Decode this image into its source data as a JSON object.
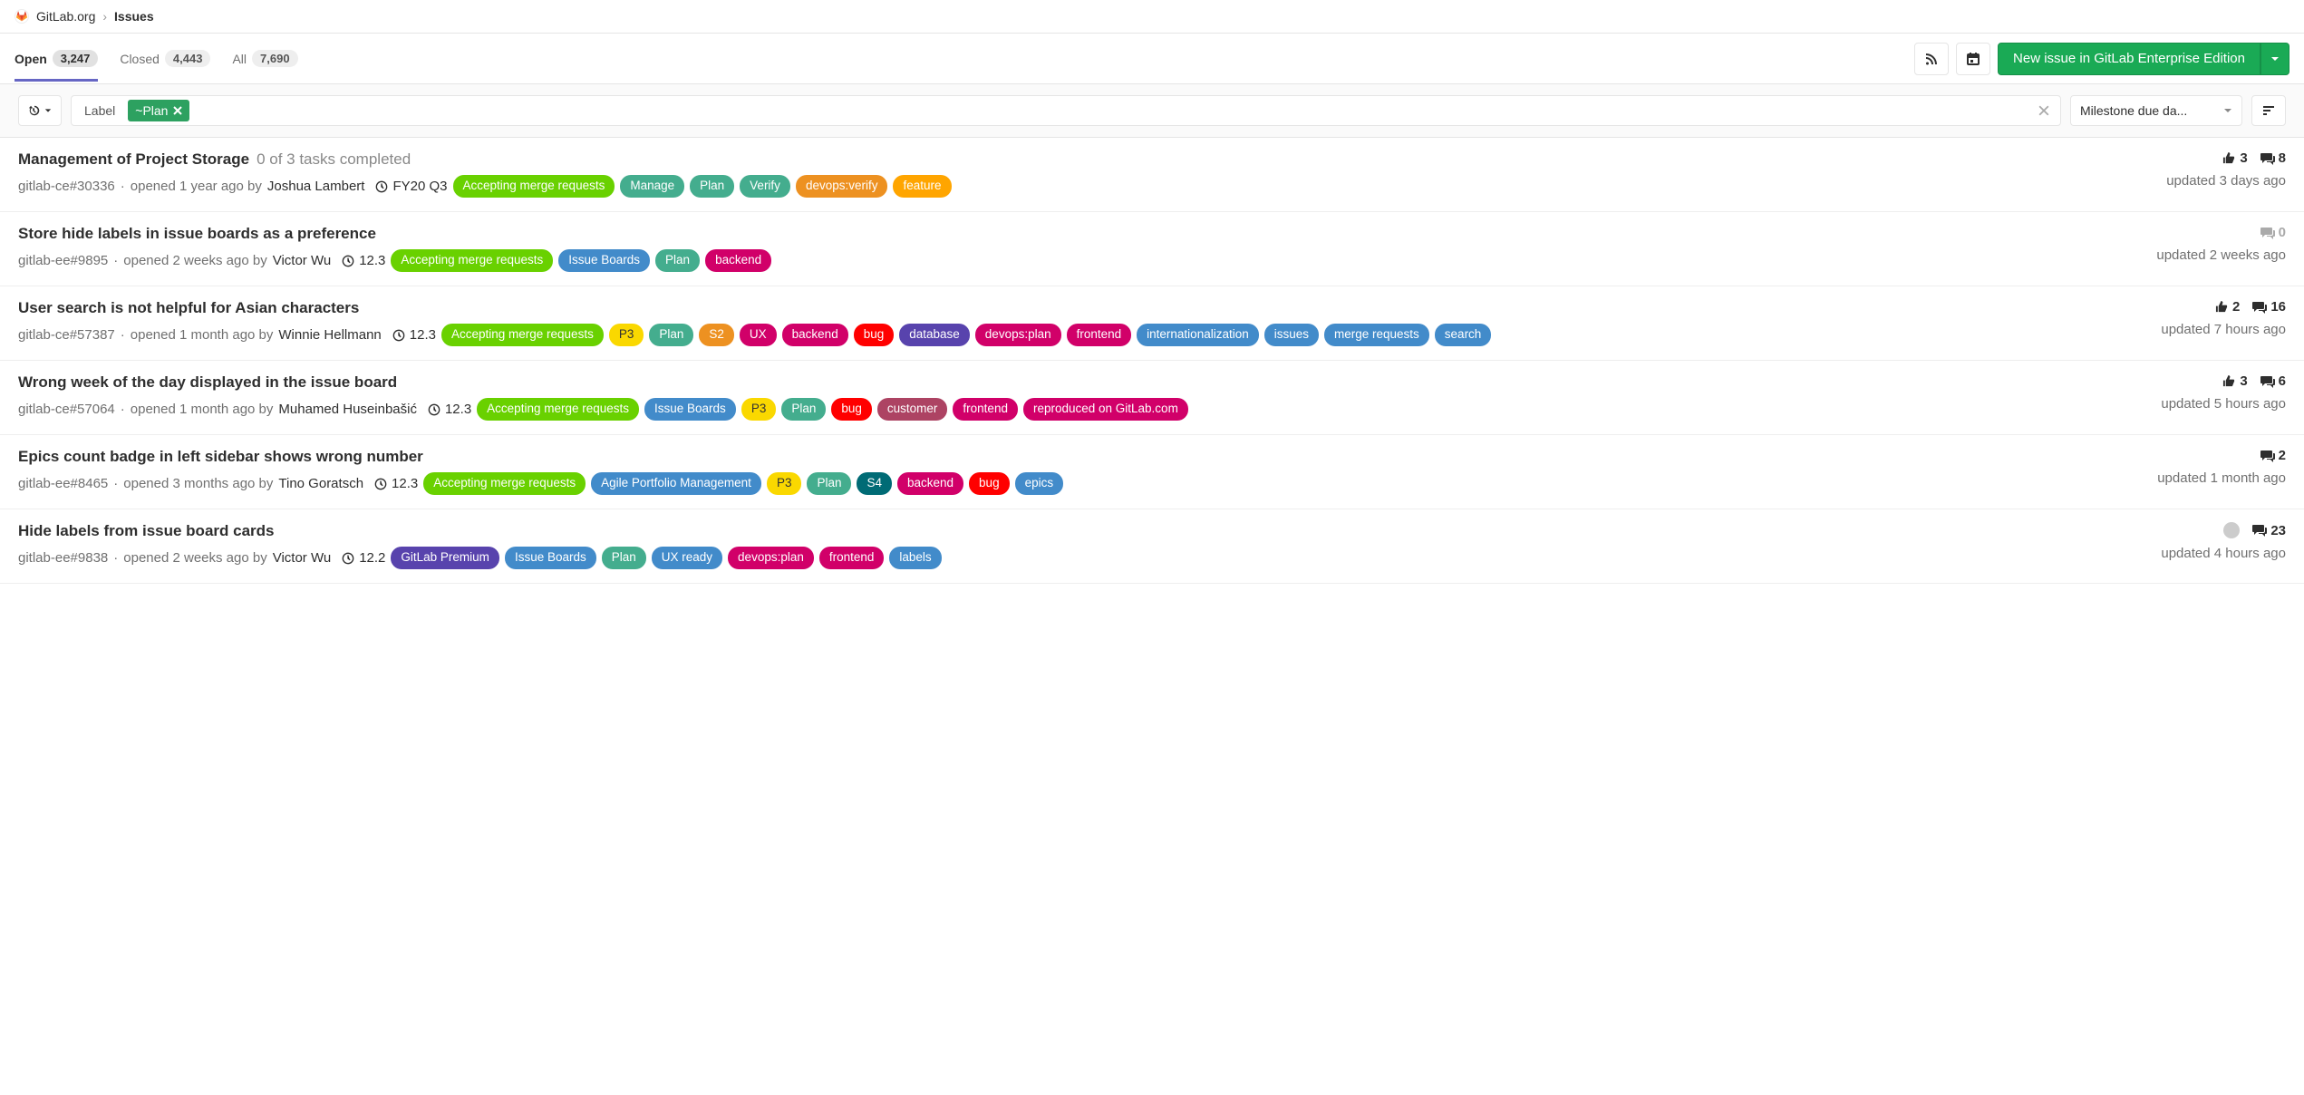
{
  "breadcrumb": {
    "group": "GitLab.org",
    "page": "Issues"
  },
  "tabs": {
    "open": {
      "label": "Open",
      "count": "3,247"
    },
    "closed": {
      "label": "Closed",
      "count": "4,443"
    },
    "all": {
      "label": "All",
      "count": "7,690"
    }
  },
  "new_issue_button": "New issue in GitLab Enterprise Edition",
  "filter": {
    "token_label": "Label",
    "token_value": "~Plan",
    "sort": "Milestone due da..."
  },
  "label_colors": {
    "Accepting merge requests": "#69d100",
    "Manage": "#44ad8e",
    "Plan": "#44ad8e",
    "Verify": "#44ad8e",
    "devops:verify": "#ed9121",
    "feature": "#ffa500",
    "Issue Boards": "#428bca",
    "backend": "#d10069",
    "P3": "#fad800",
    "S2": "#ed9121",
    "UX": "#d10069",
    "bug": "#ff0000",
    "database": "#5843ad",
    "devops:plan": "#d10069",
    "frontend": "#d10069",
    "internationalization": "#428bca",
    "issues": "#428bca",
    "merge requests": "#428bca",
    "search": "#428bca",
    "customer": "#ad4363",
    "reproduced on GitLab.com": "#d10069",
    "Agile Portfolio Management": "#428bca",
    "S4": "#006b75",
    "epics": "#428bca",
    "GitLab Premium": "#5843ad",
    "UX ready": "#428bca",
    "labels": "#428bca"
  },
  "issues": [
    {
      "title": "Management of Project Storage",
      "tasks": "0 of 3 tasks completed",
      "ref": "gitlab-ce#30336",
      "opened": "opened 1 year ago by",
      "author": "Joshua Lambert",
      "milestone": "FY20 Q3",
      "labels": [
        "Accepting merge requests",
        "Manage",
        "Plan",
        "Verify",
        "devops:verify",
        "feature"
      ],
      "thumbs": "3",
      "comments": "8",
      "updated": "updated 3 days ago",
      "has_avatar": false,
      "comments_muted": false
    },
    {
      "title": "Store hide labels in issue boards as a preference",
      "tasks": "",
      "ref": "gitlab-ee#9895",
      "opened": "opened 2 weeks ago by",
      "author": "Victor Wu",
      "milestone": "12.3",
      "labels": [
        "Accepting merge requests",
        "Issue Boards",
        "Plan",
        "backend"
      ],
      "thumbs": "",
      "comments": "0",
      "updated": "updated 2 weeks ago",
      "has_avatar": false,
      "comments_muted": true
    },
    {
      "title": "User search is not helpful for Asian characters",
      "tasks": "",
      "ref": "gitlab-ce#57387",
      "opened": "opened 1 month ago by",
      "author": "Winnie Hellmann",
      "milestone": "12.3",
      "labels": [
        "Accepting merge requests",
        "P3",
        "Plan",
        "S2",
        "UX",
        "backend",
        "bug",
        "database",
        "devops:plan",
        "frontend",
        "internationalization",
        "issues",
        "merge requests",
        "search"
      ],
      "thumbs": "2",
      "comments": "16",
      "updated": "updated 7 hours ago",
      "has_avatar": false,
      "comments_muted": false
    },
    {
      "title": "Wrong week of the day displayed in the issue board",
      "tasks": "",
      "ref": "gitlab-ce#57064",
      "opened": "opened 1 month ago by",
      "author": "Muhamed Huseinbašić",
      "milestone": "12.3",
      "labels": [
        "Accepting merge requests",
        "Issue Boards",
        "P3",
        "Plan",
        "bug",
        "customer",
        "frontend",
        "reproduced on GitLab.com"
      ],
      "thumbs": "3",
      "comments": "6",
      "updated": "updated 5 hours ago",
      "has_avatar": false,
      "comments_muted": false
    },
    {
      "title": "Epics count badge in left sidebar shows wrong number",
      "tasks": "",
      "ref": "gitlab-ee#8465",
      "opened": "opened 3 months ago by",
      "author": "Tino Goratsch",
      "milestone": "12.3",
      "labels": [
        "Accepting merge requests",
        "Agile Portfolio Management",
        "P3",
        "Plan",
        "S4",
        "backend",
        "bug",
        "epics"
      ],
      "thumbs": "",
      "comments": "2",
      "updated": "updated 1 month ago",
      "has_avatar": false,
      "comments_muted": false
    },
    {
      "title": "Hide labels from issue board cards",
      "tasks": "",
      "ref": "gitlab-ee#9838",
      "opened": "opened 2 weeks ago by",
      "author": "Victor Wu",
      "milestone": "12.2",
      "labels": [
        "GitLab Premium",
        "Issue Boards",
        "Plan",
        "UX ready",
        "devops:plan",
        "frontend",
        "labels"
      ],
      "thumbs": "",
      "comments": "23",
      "updated": "updated 4 hours ago",
      "has_avatar": true,
      "comments_muted": false
    }
  ]
}
